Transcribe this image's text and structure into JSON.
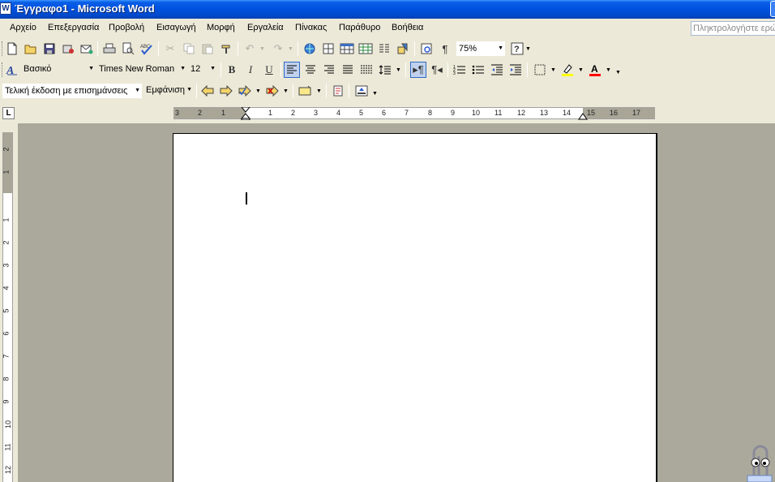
{
  "window": {
    "title": "Έγγραφο1 - Microsoft Word",
    "app_icon": "W"
  },
  "menu": {
    "items": [
      "Αρχείο",
      "Επεξεργασία",
      "Προβολή",
      "Εισαγωγή",
      "Μορφή",
      "Εργαλεία",
      "Πίνακας",
      "Παράθυρο",
      "Βοήθεια"
    ],
    "ask_placeholder": "Πληκτρολογήστε ερώτηση"
  },
  "standard_toolbar": {
    "zoom": "75%"
  },
  "formatting_toolbar": {
    "style": "Βασικό",
    "font": "Times New Roman",
    "size": "12",
    "bold_label": "B",
    "italic_label": "I",
    "underline_label": "U"
  },
  "reviewing_toolbar": {
    "display_mode": "Τελική έκδοση με επισημάνσεις",
    "show_label": "Εμφάνιση"
  },
  "ruler": {
    "tab_selector": "L",
    "h_left_numbers": [
      "3",
      "2",
      "1"
    ],
    "h_right_numbers": [
      "1",
      "2",
      "3",
      "4",
      "5",
      "6",
      "7",
      "8",
      "9",
      "10",
      "11",
      "12",
      "13",
      "14",
      "15",
      "16",
      "17"
    ],
    "v_top_numbers": [
      "2",
      "1"
    ],
    "v_body_numbers": [
      "1",
      "2",
      "3",
      "4",
      "5",
      "6",
      "7",
      "8",
      "9",
      "10",
      "11",
      "12"
    ]
  },
  "icons": {
    "new": "new-document-icon",
    "open": "open-folder-icon",
    "save": "save-icon",
    "print": "print-icon",
    "preview": "print-preview-icon",
    "spelling": "spelling-icon",
    "zoom": "zoom-icon"
  },
  "colors": {
    "titlebar": "#0054e3",
    "chrome": "#ece9d8",
    "workspace": "#aba99c",
    "highlight": "#ffff00",
    "font_color": "#ff0000"
  }
}
